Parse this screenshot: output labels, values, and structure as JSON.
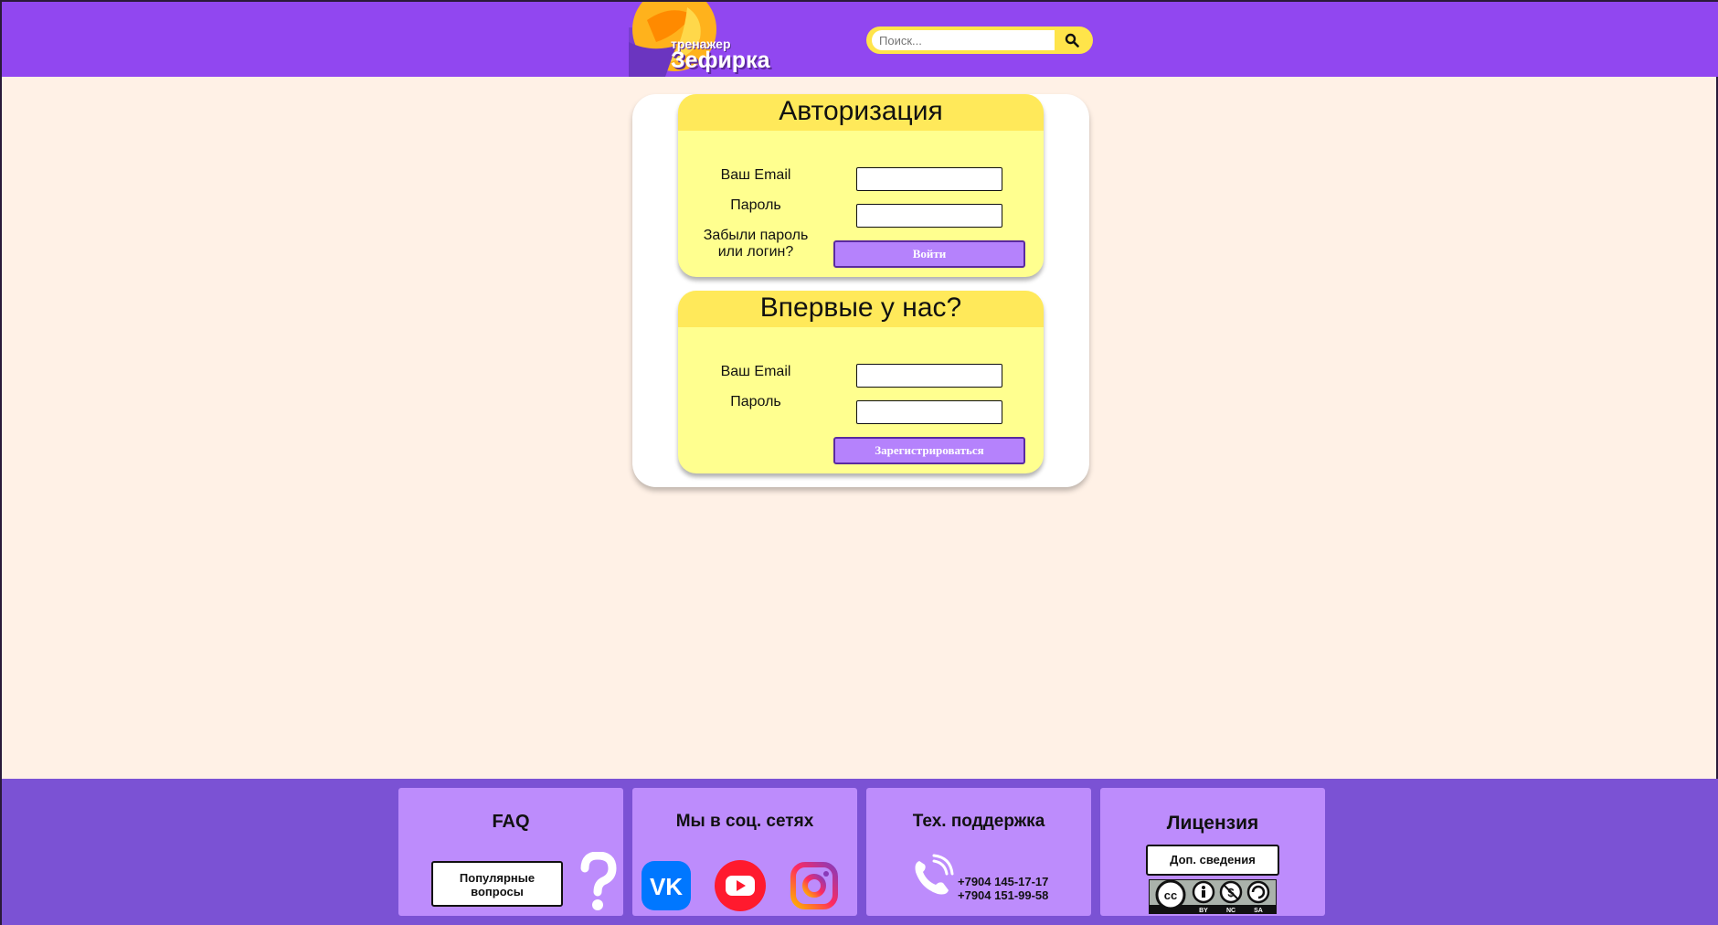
{
  "header": {
    "logo_small": "тренажер",
    "logo_big": "Зефирка",
    "search_placeholder": "Поиск..."
  },
  "login": {
    "title": "Авторизация",
    "email_label": "Ваш Email",
    "password_label": "Пароль",
    "forgot_line1": "Забыли пароль",
    "forgot_line2": "или логин?",
    "submit": "Войти"
  },
  "register": {
    "title": "Впервые у нас?",
    "email_label": "Ваш Email",
    "password_label": "Пароль",
    "submit": "Зарегистрироваться"
  },
  "footer": {
    "faq": {
      "title": "FAQ",
      "button_line1": "Популярные",
      "button_line2": "вопросы"
    },
    "social": {
      "title": "Мы в соц. сетях"
    },
    "support": {
      "title": "Тех. поддержка",
      "phone1": "+7904 145-17-17",
      "phone2": "+7904 151-99-58"
    },
    "license": {
      "title": "Лицензия",
      "button": "Доп. сведения",
      "badge_labels": [
        "BY",
        "NC",
        "SA"
      ]
    }
  },
  "colors": {
    "header_bg": "#9147f0",
    "page_bg": "#fff1e6",
    "accent_yellow": "#ffe95a",
    "panel_bg": "#ffff8f",
    "button_purple": "#b582fc",
    "footer_bg": "#7b52d4",
    "footer_box": "#bd8cfc"
  },
  "icons": [
    "logo-icon",
    "search-icon",
    "vk-icon",
    "youtube-icon",
    "instagram-icon",
    "question-icon",
    "phone-icon",
    "cc-license-icon"
  ]
}
